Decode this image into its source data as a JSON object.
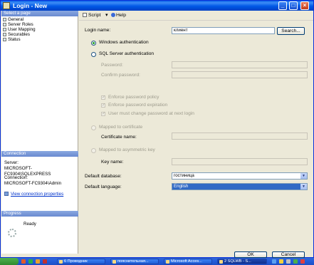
{
  "window": {
    "title": "Login - New"
  },
  "left_pane": {
    "select_page_header": "Select a page",
    "pages": [
      "General",
      "Server Roles",
      "User Mapping",
      "Securables",
      "Status"
    ],
    "connection_header": "Connection",
    "server_label": "Server:",
    "server_value": "MICROSOFT-FC9304\\SQLEXPRESS",
    "connection_label": "Connection:",
    "connection_value": "MICROSOFT-FC9304\\Admin",
    "view_properties_link": "View connection properties",
    "progress_header": "Progress",
    "progress_status": "Ready"
  },
  "toolbar": {
    "script_label": "Script",
    "script_arrow": "▾",
    "help_label": "Help"
  },
  "form": {
    "login_name_label": "Login name:",
    "login_name_value": "клиент",
    "search_button": "Search...",
    "windows_auth_label": "Windows authentication",
    "sql_auth_label": "SQL Server authentication",
    "password_label": "Password:",
    "confirm_password_label": "Confirm password:",
    "enforce_policy_label": "Enforce password policy",
    "enforce_expiration_label": "Enforce password expiration",
    "must_change_label": "User must change password at next login",
    "mapped_cert_label": "Mapped to certificate",
    "cert_name_label": "Certificate name:",
    "mapped_asym_label": "Mapped to asymmetric key",
    "key_name_label": "Key name:",
    "default_db_label": "Default database:",
    "default_db_value": "гостиница",
    "default_lang_label": "Default language:",
    "default_lang_value": "English",
    "selected_auth": "windows"
  },
  "buttons": {
    "ok": "OK",
    "cancel": "Cancel"
  },
  "taskbar": {
    "tasks": [
      {
        "label": "6 Проводник",
        "active": false
      },
      {
        "label": "пояснительная...",
        "active": false
      },
      {
        "label": "Microsoft Acces...",
        "active": false
      },
      {
        "label": "2 SQLWB - S...",
        "active": true
      }
    ]
  }
}
